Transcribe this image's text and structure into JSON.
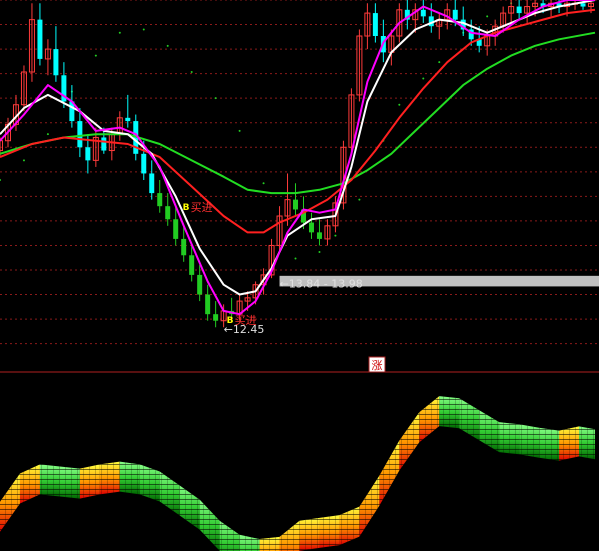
{
  "chart_data": [
    {
      "type": "candlestick",
      "panel": "main",
      "xlim": [
        0,
        150
      ],
      "ylim": [
        11.5,
        22.5
      ],
      "colors": {
        "candle_up": "#ff3b3b",
        "candle_down": "#00ffff",
        "candle_down_lower": "#22cc22",
        "ma_fast": "#ffffff",
        "ma_mid": "#ff00ff",
        "ma_slow": "#ff2020",
        "ma_long": "#22dd22",
        "dotted_band": "#22cc22",
        "grid": "#8a1a1a",
        "price_band": "#c0c0c0"
      },
      "candles": [
        [
          0,
          17.9,
          18.3,
          17.7,
          18.2
        ],
        [
          2,
          18.2,
          18.9,
          18.0,
          18.7
        ],
        [
          4,
          18.7,
          19.6,
          18.5,
          19.3
        ],
        [
          6,
          19.3,
          20.5,
          19.1,
          20.3
        ],
        [
          8,
          20.3,
          22.4,
          20.0,
          21.9
        ],
        [
          10,
          21.9,
          22.4,
          20.5,
          20.7
        ],
        [
          12,
          20.7,
          21.3,
          20.2,
          21.0
        ],
        [
          14,
          21.0,
          21.7,
          20.0,
          20.2
        ],
        [
          16,
          20.2,
          20.6,
          19.2,
          19.4
        ],
        [
          18,
          19.4,
          19.9,
          18.6,
          18.8
        ],
        [
          20,
          18.8,
          19.2,
          17.7,
          18.0
        ],
        [
          22,
          18.0,
          18.4,
          17.2,
          17.6
        ],
        [
          24,
          17.6,
          18.6,
          17.4,
          18.3
        ],
        [
          26,
          18.3,
          18.6,
          17.8,
          17.9
        ],
        [
          28,
          17.9,
          18.6,
          17.6,
          18.4
        ],
        [
          30,
          18.4,
          19.1,
          18.2,
          18.9
        ],
        [
          32,
          18.9,
          19.6,
          18.6,
          18.8
        ],
        [
          34,
          18.8,
          19.0,
          17.6,
          17.8
        ],
        [
          36,
          17.8,
          18.2,
          17.0,
          17.2
        ],
        [
          38,
          17.2,
          17.6,
          16.4,
          16.6
        ],
        [
          40,
          16.6,
          17.0,
          16.0,
          16.2
        ],
        [
          42,
          16.2,
          16.6,
          15.6,
          15.8
        ],
        [
          44,
          15.8,
          16.2,
          15.0,
          15.2
        ],
        [
          46,
          15.2,
          15.6,
          14.5,
          14.7
        ],
        [
          48,
          14.7,
          15.0,
          13.9,
          14.1
        ],
        [
          50,
          14.1,
          14.4,
          13.3,
          13.5
        ],
        [
          52,
          13.5,
          13.8,
          12.7,
          12.9
        ],
        [
          54,
          12.9,
          13.3,
          12.5,
          12.7
        ],
        [
          56,
          12.7,
          13.2,
          12.5,
          13.0
        ],
        [
          58,
          13.0,
          13.4,
          12.7,
          12.9
        ],
        [
          60,
          12.9,
          13.5,
          12.7,
          13.3
        ],
        [
          62,
          13.3,
          13.6,
          13.0,
          13.4
        ],
        [
          64,
          13.4,
          13.9,
          13.2,
          13.8
        ],
        [
          66,
          13.8,
          14.3,
          13.5,
          14.1
        ],
        [
          68,
          14.1,
          15.2,
          14.0,
          15.0
        ],
        [
          70,
          15.0,
          16.2,
          14.8,
          15.9
        ],
        [
          72,
          15.9,
          17.2,
          15.6,
          16.4
        ],
        [
          74,
          16.4,
          16.9,
          15.9,
          16.1
        ],
        [
          76,
          16.1,
          16.5,
          15.5,
          15.7
        ],
        [
          78,
          15.7,
          16.0,
          15.2,
          15.4
        ],
        [
          80,
          15.4,
          15.8,
          15.0,
          15.2
        ],
        [
          82,
          15.2,
          15.8,
          15.0,
          15.6
        ],
        [
          84,
          15.6,
          16.5,
          15.4,
          16.3
        ],
        [
          86,
          16.3,
          18.2,
          16.1,
          18.0
        ],
        [
          88,
          18.0,
          19.8,
          17.8,
          19.6
        ],
        [
          90,
          19.6,
          21.6,
          19.4,
          21.4
        ],
        [
          92,
          21.4,
          22.4,
          21.0,
          22.1
        ],
        [
          94,
          22.1,
          22.4,
          21.2,
          21.4
        ],
        [
          96,
          21.4,
          21.9,
          20.6,
          20.9
        ],
        [
          98,
          20.9,
          21.6,
          20.5,
          21.4
        ],
        [
          100,
          21.4,
          22.4,
          21.2,
          22.2
        ],
        [
          102,
          22.2,
          22.5,
          21.6,
          21.9
        ],
        [
          104,
          21.9,
          22.4,
          21.5,
          22.2
        ],
        [
          106,
          22.2,
          22.5,
          21.8,
          22.0
        ],
        [
          108,
          22.0,
          22.4,
          21.5,
          21.7
        ],
        [
          110,
          21.7,
          22.1,
          21.3,
          21.9
        ],
        [
          112,
          21.9,
          22.4,
          21.6,
          22.2
        ],
        [
          114,
          22.2,
          22.5,
          21.7,
          21.9
        ],
        [
          116,
          21.9,
          22.3,
          21.4,
          21.6
        ],
        [
          118,
          21.6,
          21.9,
          21.1,
          21.3
        ],
        [
          120,
          21.3,
          21.7,
          20.9,
          21.1
        ],
        [
          122,
          21.1,
          21.6,
          20.8,
          21.4
        ],
        [
          124,
          21.4,
          21.9,
          21.1,
          21.7
        ],
        [
          126,
          21.7,
          22.3,
          21.5,
          22.1
        ],
        [
          128,
          22.1,
          22.5,
          21.8,
          22.3
        ],
        [
          130,
          22.3,
          22.5,
          21.9,
          22.1
        ],
        [
          132,
          22.1,
          22.5,
          21.8,
          22.3
        ],
        [
          134,
          22.3,
          22.5,
          22.0,
          22.4
        ],
        [
          136,
          22.4,
          22.5,
          22.1,
          22.3
        ],
        [
          138,
          22.3,
          22.5,
          22.0,
          22.4
        ],
        [
          140,
          22.4,
          22.5,
          22.1,
          22.3
        ],
        [
          142,
          22.3,
          22.5,
          22.0,
          22.4
        ],
        [
          144,
          22.4,
          22.5,
          22.2,
          22.4
        ],
        [
          146,
          22.4,
          22.5,
          22.2,
          22.3
        ],
        [
          148,
          22.3,
          22.5,
          22.1,
          22.4
        ]
      ],
      "ma_fast": [
        [
          0,
          18.4
        ],
        [
          6,
          19.2
        ],
        [
          12,
          19.6
        ],
        [
          20,
          19.1
        ],
        [
          26,
          18.5
        ],
        [
          32,
          18.4
        ],
        [
          38,
          17.8
        ],
        [
          44,
          16.5
        ],
        [
          50,
          14.9
        ],
        [
          56,
          13.8
        ],
        [
          60,
          13.5
        ],
        [
          64,
          13.6
        ],
        [
          68,
          14.3
        ],
        [
          72,
          15.3
        ],
        [
          78,
          15.8
        ],
        [
          84,
          15.9
        ],
        [
          88,
          17.4
        ],
        [
          92,
          19.4
        ],
        [
          98,
          20.9
        ],
        [
          104,
          21.6
        ],
        [
          110,
          21.9
        ],
        [
          116,
          21.8
        ],
        [
          122,
          21.5
        ],
        [
          128,
          21.8
        ],
        [
          134,
          22.1
        ],
        [
          140,
          22.3
        ],
        [
          149,
          22.5
        ]
      ],
      "ma_mid": [
        [
          0,
          18.2
        ],
        [
          6,
          19.0
        ],
        [
          12,
          19.9
        ],
        [
          18,
          19.4
        ],
        [
          24,
          18.5
        ],
        [
          30,
          18.6
        ],
        [
          34,
          18.4
        ],
        [
          40,
          17.4
        ],
        [
          46,
          15.6
        ],
        [
          52,
          13.9
        ],
        [
          56,
          13.0
        ],
        [
          60,
          12.9
        ],
        [
          64,
          13.3
        ],
        [
          68,
          14.2
        ],
        [
          72,
          15.4
        ],
        [
          76,
          16.1
        ],
        [
          80,
          16.0
        ],
        [
          84,
          16.1
        ],
        [
          88,
          17.8
        ],
        [
          92,
          20.0
        ],
        [
          96,
          21.2
        ],
        [
          100,
          21.8
        ],
        [
          106,
          22.3
        ],
        [
          112,
          22.0
        ],
        [
          118,
          21.5
        ],
        [
          124,
          21.4
        ],
        [
          130,
          21.9
        ],
        [
          136,
          22.3
        ],
        [
          142,
          22.5
        ],
        [
          149,
          22.5
        ]
      ],
      "ma_slow": [
        [
          0,
          17.7
        ],
        [
          8,
          18.1
        ],
        [
          16,
          18.3
        ],
        [
          24,
          18.2
        ],
        [
          32,
          18.1
        ],
        [
          40,
          17.7
        ],
        [
          48,
          16.8
        ],
        [
          56,
          15.9
        ],
        [
          62,
          15.4
        ],
        [
          66,
          15.4
        ],
        [
          70,
          15.7
        ],
        [
          76,
          16.0
        ],
        [
          82,
          16.4
        ],
        [
          88,
          17.0
        ],
        [
          94,
          17.9
        ],
        [
          100,
          18.9
        ],
        [
          106,
          19.8
        ],
        [
          112,
          20.6
        ],
        [
          118,
          21.2
        ],
        [
          124,
          21.5
        ],
        [
          130,
          21.7
        ],
        [
          136,
          21.9
        ],
        [
          142,
          22.1
        ],
        [
          149,
          22.2
        ]
      ],
      "ma_long": [
        [
          0,
          17.8
        ],
        [
          8,
          18.1
        ],
        [
          16,
          18.3
        ],
        [
          24,
          18.4
        ],
        [
          32,
          18.4
        ],
        [
          40,
          18.1
        ],
        [
          48,
          17.6
        ],
        [
          56,
          17.1
        ],
        [
          62,
          16.7
        ],
        [
          68,
          16.6
        ],
        [
          74,
          16.6
        ],
        [
          80,
          16.7
        ],
        [
          86,
          16.9
        ],
        [
          92,
          17.3
        ],
        [
          98,
          17.8
        ],
        [
          104,
          18.5
        ],
        [
          110,
          19.2
        ],
        [
          116,
          19.9
        ],
        [
          122,
          20.4
        ],
        [
          128,
          20.8
        ],
        [
          134,
          21.1
        ],
        [
          140,
          21.3
        ],
        [
          149,
          21.5
        ]
      ],
      "dotted_band": [
        [
          0,
          17.0
        ],
        [
          6,
          17.6
        ],
        [
          12,
          18.4
        ],
        [
          18,
          19.7
        ],
        [
          24,
          20.8
        ],
        [
          30,
          21.5
        ],
        [
          36,
          21.6
        ],
        [
          42,
          21.1
        ],
        [
          48,
          20.3
        ],
        [
          54,
          19.5
        ],
        [
          60,
          18.5
        ],
        [
          66,
          16.9
        ],
        [
          70,
          15.0
        ],
        [
          74,
          14.6
        ],
        [
          80,
          14.8
        ],
        [
          84,
          15.3
        ],
        [
          90,
          16.4
        ],
        [
          96,
          18.2
        ],
        [
          100,
          19.3
        ],
        [
          106,
          20.1
        ],
        [
          110,
          20.6
        ],
        [
          116,
          21.5
        ],
        [
          122,
          22.0
        ],
        [
          128,
          22.4
        ],
        [
          134,
          22.6
        ]
      ],
      "price_band": {
        "from": 13.84,
        "to": 13.98,
        "x_start": 70
      },
      "annotations": [
        {
          "label": "13.84 - 13.98",
          "x": 70,
          "y": 13.84,
          "arrow": "←"
        },
        {
          "label": "12.45",
          "x": 56,
          "y": 12.45,
          "arrow": "←"
        },
        {
          "label": "买进",
          "x": 47,
          "y": 16.2,
          "marker": "B"
        },
        {
          "label": "买进",
          "x": 58,
          "y": 12.75,
          "marker": "B"
        }
      ],
      "grid": true
    },
    {
      "type": "area",
      "panel": "indicator",
      "xlim": [
        0,
        150
      ],
      "ylim": [
        -1.25,
        1.25
      ],
      "marker": "涨",
      "values": [
        [
          0,
          -0.55
        ],
        [
          5,
          -0.15
        ],
        [
          10,
          -0.02
        ],
        [
          15,
          -0.05
        ],
        [
          20,
          -0.08
        ],
        [
          25,
          -0.02
        ],
        [
          30,
          0.02
        ],
        [
          35,
          -0.02
        ],
        [
          40,
          -0.12
        ],
        [
          45,
          -0.32
        ],
        [
          50,
          -0.52
        ],
        [
          55,
          -0.82
        ],
        [
          60,
          -1.02
        ],
        [
          65,
          -1.08
        ],
        [
          70,
          -1.05
        ],
        [
          75,
          -0.82
        ],
        [
          80,
          -0.78
        ],
        [
          85,
          -0.74
        ],
        [
          90,
          -0.62
        ],
        [
          95,
          -0.18
        ],
        [
          100,
          0.32
        ],
        [
          105,
          0.72
        ],
        [
          110,
          0.95
        ],
        [
          115,
          0.92
        ],
        [
          120,
          0.75
        ],
        [
          125,
          0.58
        ],
        [
          130,
          0.55
        ],
        [
          135,
          0.5
        ],
        [
          140,
          0.46
        ],
        [
          145,
          0.52
        ],
        [
          149,
          0.48
        ]
      ],
      "colors": {
        "rising": [
          "#ffff40",
          "#ff9900",
          "#dd0000"
        ],
        "falling": [
          "#88ff88",
          "#33cc33",
          "#006600"
        ],
        "hatch": "#000000"
      }
    }
  ]
}
